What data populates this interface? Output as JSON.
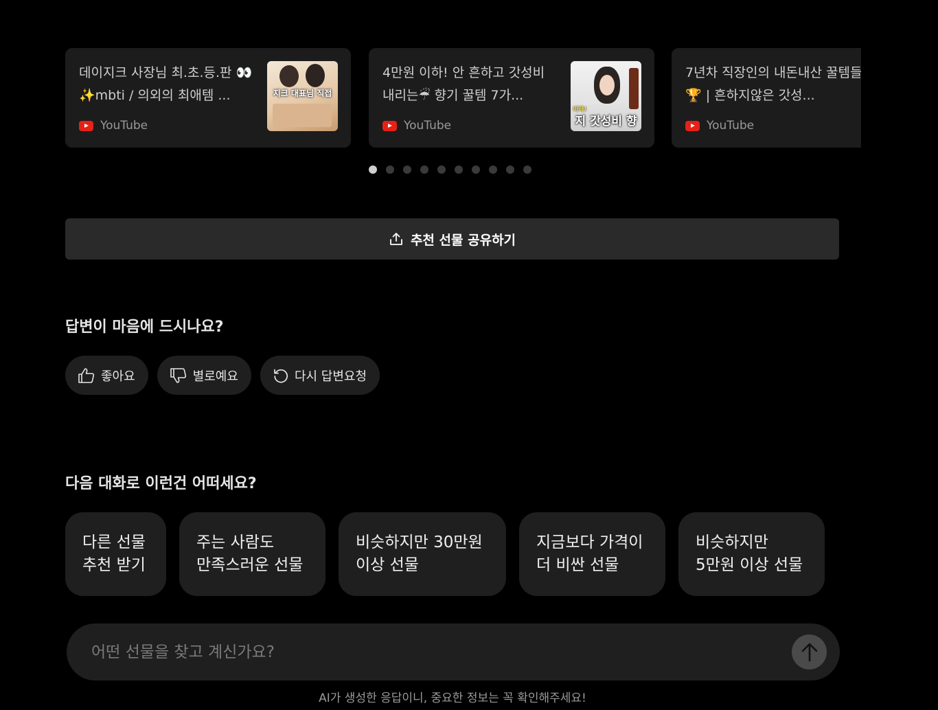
{
  "videos": [
    {
      "title": "데이지크 사장님 최.초.등.판 👀✨mbti / 의외의 최애템 ...",
      "source": "YouTube",
      "thumb_text": "지크 대표님 직접"
    },
    {
      "title": "4만원 이하! 안 흔하고 갓성비 내리는☔ 향기 꿀템 7가...",
      "source": "YouTube",
      "thumb_text": "지 갓성비 향",
      "thumb_small": "이하!"
    },
    {
      "title": "7년차 직장인의 내돈내산 꿀템들🏆 | 흔하지않은 갓성...",
      "source": "YouTube"
    }
  ],
  "carousel": {
    "page_count": 10,
    "active_index": 0
  },
  "share_button": {
    "label": "추천 선물 공유하기",
    "icon": "share-upload-icon"
  },
  "feedback": {
    "title": "답변이 마음에 드시나요?",
    "buttons": [
      {
        "label": "좋아요",
        "icon": "thumbs-up-icon"
      },
      {
        "label": "별로예요",
        "icon": "thumbs-down-icon"
      },
      {
        "label": "다시 답변요청",
        "icon": "refresh-icon"
      }
    ]
  },
  "suggestions": {
    "title": "다음 대화로 이런건 어떠세요?",
    "items": [
      "다른 선물\n추천 받기",
      "주는 사람도\n만족스러운 선물",
      "비슷하지만 30만원\n이상 선물",
      "지금보다 가격이\n더 비싼 선물",
      "비슷하지만\n5만원 이상 선물"
    ]
  },
  "input": {
    "placeholder": "어떤 선물을 찾고 계신가요?",
    "send_icon": "arrow-up-icon"
  },
  "disclaimer": "AI가 생성한 응답이니, 중요한 정보는 꼭 확인해주세요!",
  "colors": {
    "background": "#000000",
    "card": "#1c1c1c",
    "button": "#2a2a2a",
    "pill": "#1f1f1f",
    "youtube": "#e62117"
  }
}
